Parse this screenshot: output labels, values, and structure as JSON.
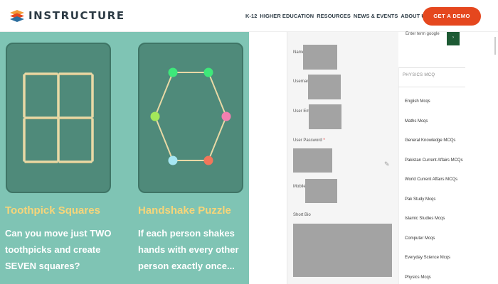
{
  "header": {
    "logo_text": "INSTRUCTURE",
    "nav": [
      "K-12",
      "HIGHER EDUCATION",
      "RESOURCES",
      "NEWS & EVENTS",
      "ABOUT US"
    ],
    "cta": "GET A DEMO"
  },
  "puzzles": [
    {
      "title": "Toothpick Squares",
      "desc": "Can you move just TWO toothpicks and create SEVEN squares?"
    },
    {
      "title": "Handshake Puzzle",
      "desc": "If each person shakes hands with every other person exactly once..."
    }
  ],
  "form": {
    "fields": [
      "Name",
      "Username",
      "User Email",
      "User Password",
      "Mobile No",
      "Short Bio"
    ]
  },
  "sidebar": {
    "search_label": "Enter term google",
    "search_button": "›",
    "heading": "PHYSICS MCQ",
    "items": [
      "English Mcqs",
      "Maths Mcqs",
      "General Knowledge MCQs",
      "Pakistan Current Affairs MCQs",
      "World Current Affairs MCQs",
      "Pak Study Mcqs",
      "Islamic Studies Mcqs",
      "Computer Mcqs",
      "Everyday Science Mcqs",
      "Physics Mcqs"
    ]
  },
  "colors": {
    "teal_bg": "#7fc4b4",
    "card_bg": "#4f8a7a",
    "title_yellow": "#f6d57a",
    "cta_orange": "#e5471e"
  }
}
